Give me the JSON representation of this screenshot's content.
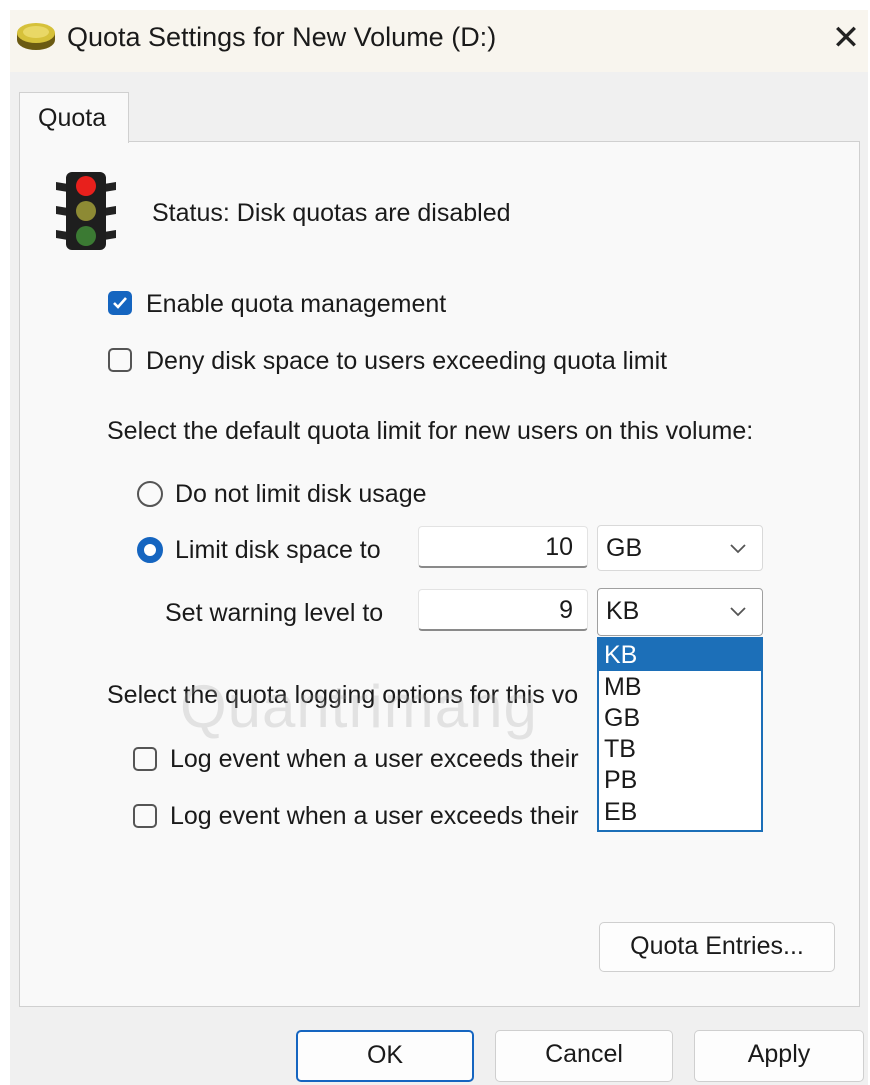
{
  "window": {
    "title": "Quota Settings for New Volume (D:)",
    "close_glyph": "✕",
    "icon": "disk-drive-icon"
  },
  "tabs": [
    {
      "label": "Quota",
      "active": true
    }
  ],
  "status": {
    "icon": "traffic-light-icon",
    "text": "Status:  Disk quotas are disabled"
  },
  "options": {
    "enable_quota": {
      "label": "Enable quota management",
      "checked": true
    },
    "deny_space": {
      "label": "Deny disk space to users exceeding quota limit",
      "checked": false
    }
  },
  "default_limit": {
    "heading": "Select the default quota limit for new users on this volume:",
    "no_limit": {
      "label": "Do not limit disk usage",
      "selected": false
    },
    "limit": {
      "label": "Limit disk space to",
      "selected": true,
      "value": "10",
      "unit": "GB"
    },
    "warning": {
      "label": "Set warning level to",
      "value": "9",
      "unit": "KB"
    },
    "unit_options": [
      "KB",
      "MB",
      "GB",
      "TB",
      "PB",
      "EB"
    ],
    "unit_selected": "KB"
  },
  "logging": {
    "heading": "Select the quota logging options for this vo",
    "log_limit": {
      "label": "Log event when a user exceeds their",
      "checked": false
    },
    "log_warning": {
      "label": "Log event when a user exceeds their",
      "checked": false
    }
  },
  "buttons": {
    "quota_entries": "Quota Entries...",
    "ok": "OK",
    "cancel": "Cancel",
    "apply": "Apply"
  },
  "watermark": "Quantrimang",
  "colors": {
    "accent": "#1565c0",
    "list_highlight": "#1c6fb8"
  }
}
